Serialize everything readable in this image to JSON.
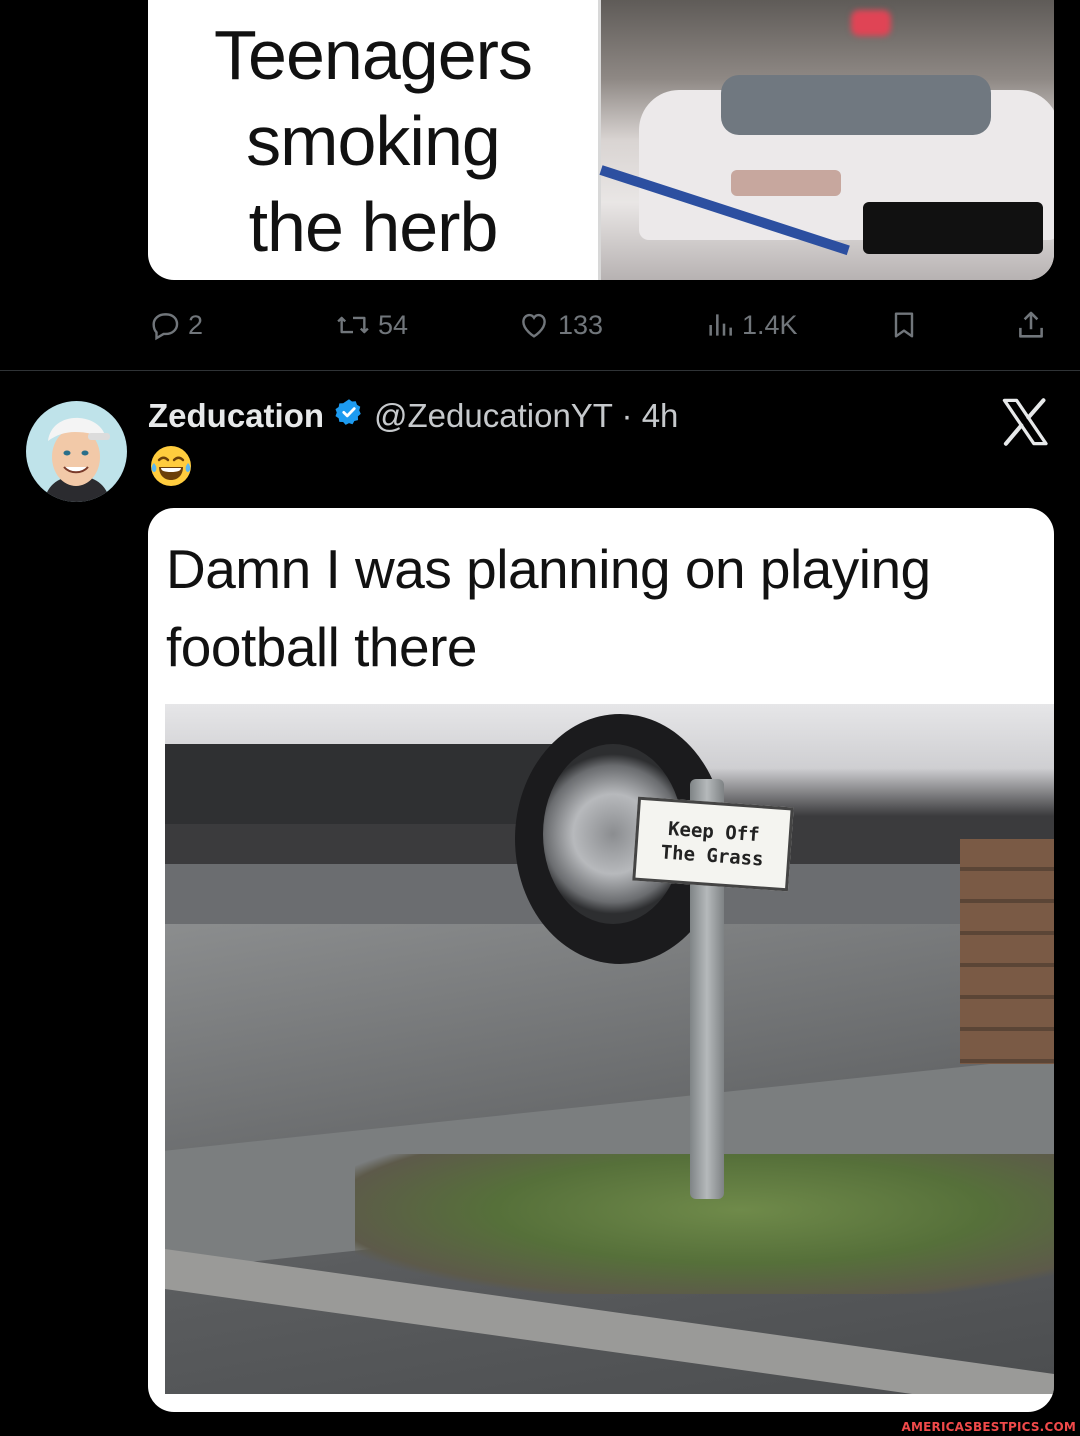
{
  "prev_tweet": {
    "meme_lines": [
      "Teenagers",
      "smoking",
      "the herb"
    ],
    "actions": {
      "replies": "2",
      "reposts": "54",
      "likes": "133",
      "views": "1.4K"
    }
  },
  "tweet": {
    "author_name": "Zeducation",
    "handle_time": "@ZeducationYT · 4h",
    "emoji": "😂",
    "meme_caption": "Damn I was planning on playing football there",
    "sign_lines": [
      "Keep Off",
      "The Grass"
    ]
  },
  "watermark": "AMERICASBESTPICS.COM",
  "icons": {
    "reply": "reply-icon",
    "repost": "repost-icon",
    "like": "heart-icon",
    "views": "views-icon",
    "bookmark": "bookmark-icon",
    "share": "share-icon",
    "verified": "verified-badge-icon",
    "platform": "x-logo-icon"
  },
  "colors": {
    "background": "#000000",
    "verified": "#1d9bf0",
    "muted": "#71767b",
    "watermark": "#f04a4a"
  }
}
